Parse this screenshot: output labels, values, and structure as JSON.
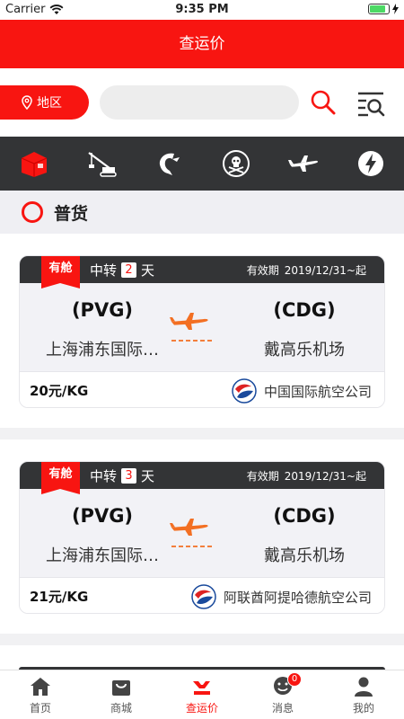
{
  "status_bar": {
    "carrier": "Carrier",
    "time": "9:35 PM",
    "battery_level": 0.85
  },
  "nav": {
    "title": "查运价"
  },
  "search": {
    "region_label": "地区",
    "placeholder": ""
  },
  "categories": [
    "package-icon",
    "crane-icon",
    "seafood-icon",
    "hazard-icon",
    "airplane-icon",
    "lightning-icon"
  ],
  "section": {
    "title": "普货"
  },
  "cards": [
    {
      "flag": "有舱",
      "transfer_prefix": "中转",
      "transfer_days": "2",
      "transfer_suffix": "天",
      "validity_label": "有效期",
      "validity_value": "2019/12/31~起",
      "origin_code": "(PVG)",
      "origin_name": "上海浦东国际…",
      "dest_code": "(CDG)",
      "dest_name": "戴高乐机场",
      "price": "20元/KG",
      "airline": "中国国际航空公司"
    },
    {
      "flag": "有舱",
      "transfer_prefix": "中转",
      "transfer_days": "3",
      "transfer_suffix": "天",
      "validity_label": "有效期",
      "validity_value": "2019/12/31~起",
      "origin_code": "(PVG)",
      "origin_name": "上海浦东国际…",
      "dest_code": "(CDG)",
      "dest_name": "戴高乐机场",
      "price": "21元/KG",
      "airline": "阿联酋阿提哈德航空公司"
    }
  ],
  "tabbar": {
    "items": [
      {
        "label": "首页",
        "icon": "home-icon"
      },
      {
        "label": "商城",
        "icon": "shop-icon"
      },
      {
        "label": "查运价",
        "icon": "freight-icon"
      },
      {
        "label": "消息",
        "icon": "message-icon",
        "badge": "0"
      },
      {
        "label": "我的",
        "icon": "profile-icon"
      }
    ]
  },
  "colors": {
    "brand_red": "#f81511",
    "dark_bar": "#333436",
    "plane_orange": "#f36f22"
  }
}
